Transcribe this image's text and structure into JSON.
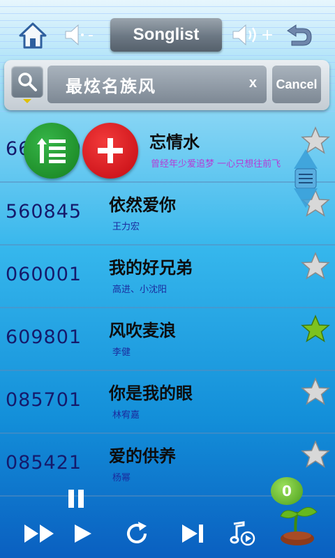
{
  "header": {
    "title": "Songlist",
    "volume_down_label": "-",
    "volume_up_label": "+"
  },
  "search": {
    "value": "最炫名族风",
    "clear_label": "x",
    "cancel_label": "Cancel"
  },
  "songs": [
    {
      "code": "664779",
      "title": "忘情水",
      "artist": "曾经年少爱追梦 一心只想往前飞",
      "favorite": false
    },
    {
      "code": "560845",
      "title": "依然爱你",
      "artist": "王力宏",
      "favorite": false
    },
    {
      "code": "060001",
      "title": "我的好兄弟",
      "artist": "高进、小沈阳",
      "favorite": false
    },
    {
      "code": "609801",
      "title": "风吹麦浪",
      "artist": "李健",
      "favorite": true
    },
    {
      "code": "085701",
      "title": "你是我的眼",
      "artist": "林宥嘉",
      "favorite": false
    },
    {
      "code": "085421",
      "title": "爱的供养",
      "artist": "杨幂",
      "favorite": false
    }
  ],
  "playlist_count": "0",
  "icons": {
    "home": "home-icon",
    "volume_down": "volume-down-icon",
    "volume_up": "volume-up-icon",
    "back": "back-arrow-icon",
    "search": "search-icon",
    "queue": "queue-top-icon",
    "add": "add-icon",
    "star": "star-icon",
    "pause": "pause-icon",
    "fast_forward": "fast-forward-icon",
    "play": "play-icon",
    "replay": "replay-icon",
    "next": "skip-next-icon",
    "music_mode": "music-play-icon",
    "plant": "sprout-icon"
  },
  "colors": {
    "accent_green": "#1e9b2e",
    "accent_red": "#e0121c",
    "star_fav": "#7dc21f",
    "star_normal": "#d8d8d8"
  }
}
